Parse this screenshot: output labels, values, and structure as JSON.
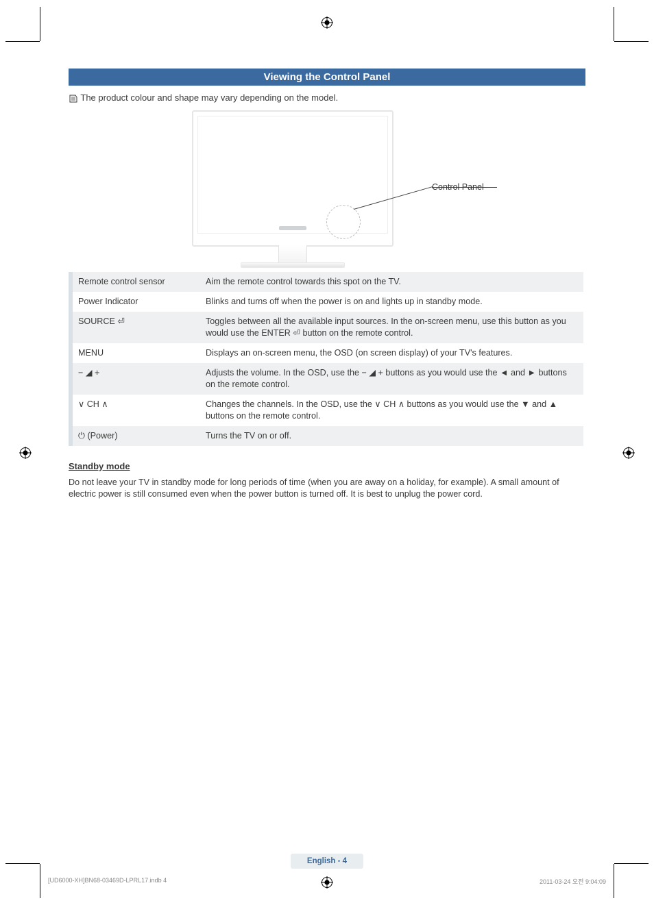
{
  "title": "Viewing the Control Panel",
  "note": "The product colour and shape may vary depending on the model.",
  "figure_label": "Control Panel",
  "table": [
    {
      "label": "Remote control sensor",
      "desc": "Aim the remote control towards this spot on the TV."
    },
    {
      "label": "Power Indicator",
      "desc": "Blinks and turns off when the power is on and lights up in standby mode."
    },
    {
      "label": "SOURCE ⏎",
      "desc": "Toggles between all the available input sources. In the on-screen menu, use this button as you would use the ENTER ⏎ button on the remote control."
    },
    {
      "label": "MENU",
      "desc": "Displays an on-screen menu, the OSD (on screen display) of your TV's features."
    },
    {
      "label": "− ◢ +",
      "desc": "Adjusts the volume. In the OSD, use the − ◢ + buttons as you would use the ◄ and ► buttons on the remote control."
    },
    {
      "label": "∨ CH ∧",
      "desc": "Changes the channels. In the OSD, use the ∨ CH ∧ buttons as you would use the ▼ and ▲ buttons on the remote control."
    },
    {
      "label": "⏻ (Power)",
      "desc": "Turns the TV on or off."
    }
  ],
  "standby_heading": "Standby mode",
  "standby_para": "Do not leave your TV in standby mode for long periods of time (when you are away on a holiday, for example). A small amount of electric power is still consumed even when the power button is turned off. It is best to unplug the power cord.",
  "footer": "English - 4",
  "print_file": "[UD6000-XH]BN68-03469D-LPRL17.indb   4",
  "print_date": "2011-03-24   오전 9:04:09"
}
